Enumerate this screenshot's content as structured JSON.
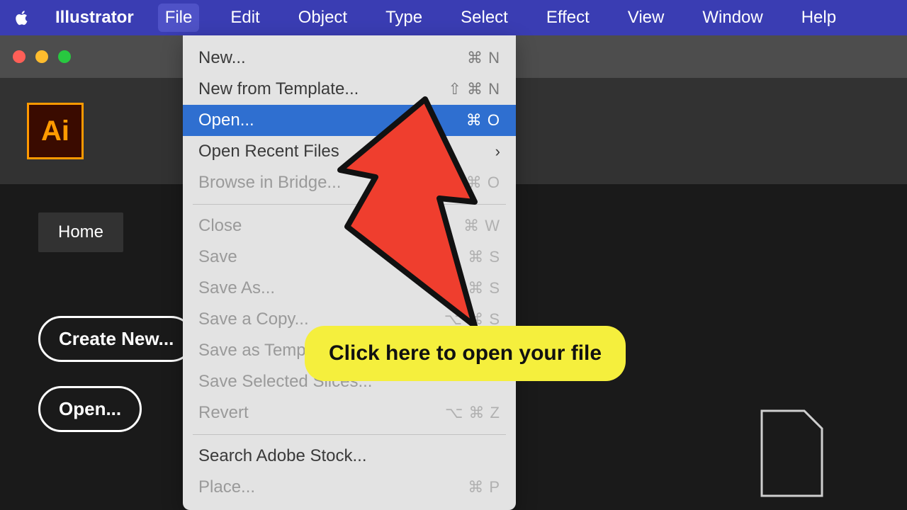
{
  "menubar": {
    "app_name": "Illustrator",
    "items": [
      "File",
      "Edit",
      "Object",
      "Type",
      "Select",
      "Effect",
      "View",
      "Window",
      "Help"
    ],
    "active_index": 0
  },
  "logo_text": "Ai",
  "tab_home": "Home",
  "buttons": {
    "create_new": "Create New...",
    "open": "Open..."
  },
  "file_menu": {
    "groups": [
      [
        {
          "label": "New...",
          "shortcut": "⌘ N",
          "highlighted": false,
          "disabled": false,
          "submenu": false
        },
        {
          "label": "New from Template...",
          "shortcut": "⇧ ⌘ N",
          "highlighted": false,
          "disabled": false,
          "submenu": false
        },
        {
          "label": "Open...",
          "shortcut": "⌘ O",
          "highlighted": true,
          "disabled": false,
          "submenu": false
        },
        {
          "label": "Open Recent Files",
          "shortcut": "",
          "highlighted": false,
          "disabled": false,
          "submenu": true
        },
        {
          "label": "Browse in Bridge...",
          "shortcut": "⌥ ⌘ O",
          "highlighted": false,
          "disabled": true,
          "submenu": false
        }
      ],
      [
        {
          "label": "Close",
          "shortcut": "⌘ W",
          "highlighted": false,
          "disabled": true,
          "submenu": false
        },
        {
          "label": "Save",
          "shortcut": "⌘ S",
          "highlighted": false,
          "disabled": true,
          "submenu": false
        },
        {
          "label": "Save As...",
          "shortcut": "⇧ ⌘ S",
          "highlighted": false,
          "disabled": true,
          "submenu": false
        },
        {
          "label": "Save a Copy...",
          "shortcut": "⌥ ⌘ S",
          "highlighted": false,
          "disabled": true,
          "submenu": false
        },
        {
          "label": "Save as Template...",
          "shortcut": "",
          "highlighted": false,
          "disabled": true,
          "submenu": false
        },
        {
          "label": "Save Selected Slices...",
          "shortcut": "",
          "highlighted": false,
          "disabled": true,
          "submenu": false
        },
        {
          "label": "Revert",
          "shortcut": "⌥ ⌘ Z",
          "highlighted": false,
          "disabled": true,
          "submenu": false
        }
      ],
      [
        {
          "label": "Search Adobe Stock...",
          "shortcut": "",
          "highlighted": false,
          "disabled": false,
          "submenu": false
        },
        {
          "label": "Place...",
          "shortcut": "⌘ P",
          "highlighted": false,
          "disabled": true,
          "submenu": false
        }
      ]
    ]
  },
  "callout_text": "Click here to open your file"
}
